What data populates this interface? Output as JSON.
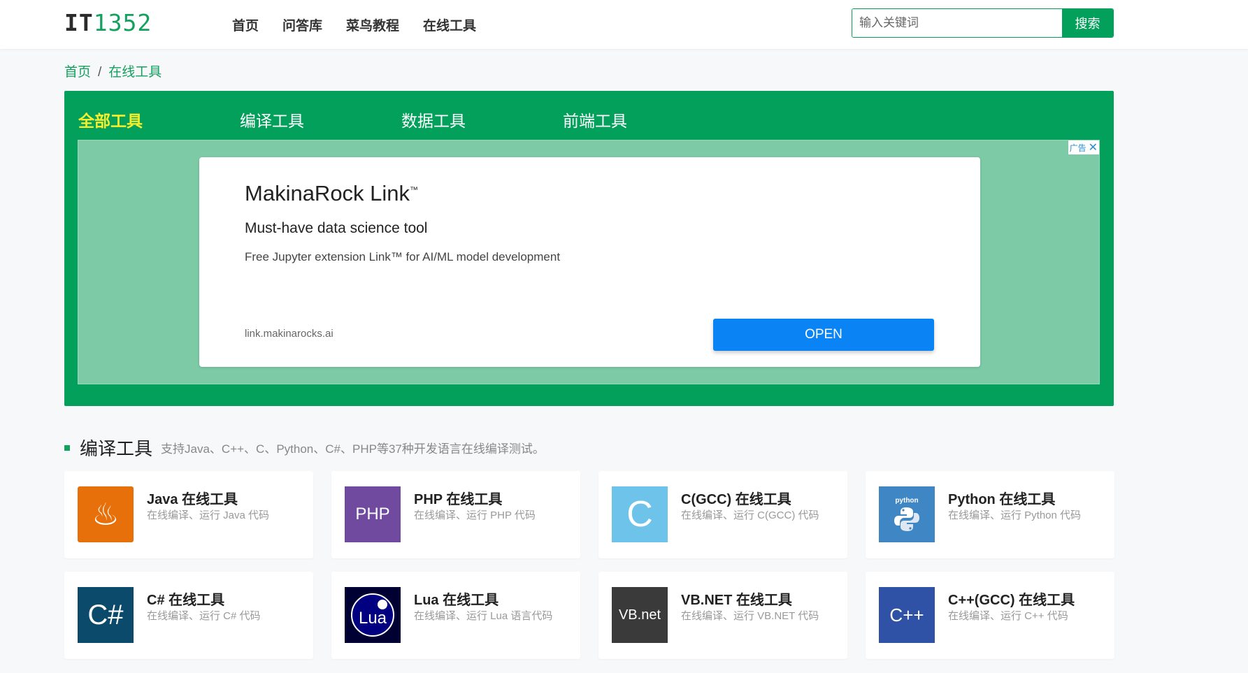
{
  "header": {
    "logo_prefix": "IT",
    "logo_suffix": "1352",
    "nav": [
      "首页",
      "问答库",
      "菜鸟教程",
      "在线工具"
    ],
    "search_placeholder": "输入关键词",
    "search_button": "搜索"
  },
  "breadcrumb": {
    "home": "首页",
    "sep": "/",
    "current": "在线工具"
  },
  "categories": [
    "全部工具",
    "编译工具",
    "数据工具",
    "前端工具"
  ],
  "ad": {
    "badge": "广告",
    "title": "MakinaRock Link",
    "title_mark": "™",
    "subtitle": "Must-have data science tool",
    "description": "Free Jupyter extension Link™ for AI/ML model development",
    "url": "link.makinarocks.ai",
    "button": "OPEN"
  },
  "section": {
    "title": "编译工具",
    "description": "支持Java、C++、C、Python、C#、PHP等37种开发语言在线编译测试。"
  },
  "tools": [
    {
      "name": "Java 在线工具",
      "desc": "在线编译、运行 Java 代码",
      "icon": "java-icon",
      "icon_text": "♨",
      "color": "#e8700a"
    },
    {
      "name": "PHP 在线工具",
      "desc": "在线编译、运行 PHP 代码",
      "icon": "php-icon",
      "icon_text": "PHP",
      "color": "#6f4a9f"
    },
    {
      "name": "C(GCC) 在线工具",
      "desc": "在线编译、运行 C(GCC) 代码",
      "icon": "c-icon",
      "icon_text": "C",
      "color": "#6ec3ea"
    },
    {
      "name": "Python 在线工具",
      "desc": "在线编译、运行 Python 代码",
      "icon": "python-icon",
      "icon_text": "python",
      "color": "#3f86c4"
    },
    {
      "name": "C# 在线工具",
      "desc": "在线编译、运行 C# 代码",
      "icon": "csharp-icon",
      "icon_text": "C#",
      "color": "#0b4a6a"
    },
    {
      "name": "Lua 在线工具",
      "desc": "在线编译、运行 Lua 语言代码",
      "icon": "lua-icon",
      "icon_text": "Lua",
      "color": "#000033"
    },
    {
      "name": "VB.NET 在线工具",
      "desc": "在线编译、运行 VB.NET 代码",
      "icon": "vbnet-icon",
      "icon_text": "VB.net",
      "color": "#3a3a3a"
    },
    {
      "name": "C++(GCC) 在线工具",
      "desc": "在线编译、运行 C++ 代码",
      "icon": "cpp-icon",
      "icon_text": "C++",
      "color": "#2f52a6"
    }
  ],
  "colors": {
    "brand": "#03a05c",
    "accent_yellow": "#f5ee2c",
    "ad_button": "#0a84f5"
  }
}
